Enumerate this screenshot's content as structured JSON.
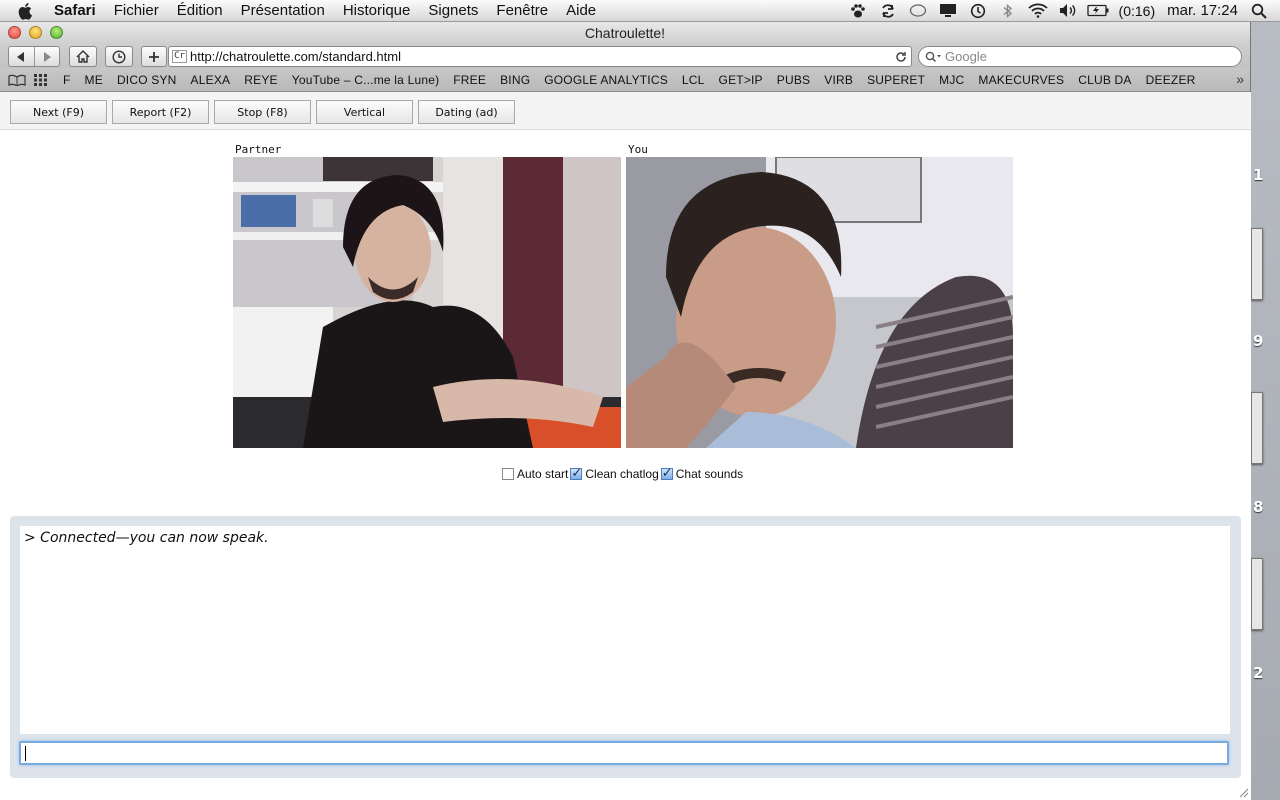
{
  "menubar": {
    "app": "Safari",
    "menus": [
      "Fichier",
      "Édition",
      "Présentation",
      "Historique",
      "Signets",
      "Fenêtre",
      "Aide"
    ],
    "battery": "(0:16)",
    "clock": "mar. 17:24"
  },
  "window": {
    "title": "Chatroulette!"
  },
  "toolbar": {
    "url": "http://chatroulette.com/standard.html",
    "favicon_text": "Cr",
    "search_placeholder": "Google"
  },
  "bookmarks": [
    "F",
    "ME",
    "DICO SYN",
    "ALEXA",
    "REYE",
    "YouTube – C...me la Lune)",
    "FREE",
    "BING",
    "GOOGLE ANALYTICS",
    "LCL",
    "GET>IP",
    "PUBS",
    "VIRB",
    "SUPERET",
    "MJC",
    "MAKECURVES",
    "CLUB DA",
    "DEEZER"
  ],
  "page": {
    "buttons": [
      "Next (F9)",
      "Report (F2)",
      "Stop (F8)",
      "Vertical",
      "Dating (ad)"
    ],
    "partner_label": "Partner",
    "you_label": "You",
    "options": [
      {
        "label": "Auto start",
        "checked": false
      },
      {
        "label": "Clean chatlog",
        "checked": true
      },
      {
        "label": "Chat sounds",
        "checked": true
      }
    ],
    "chatlog": "> Connected—you can now speak."
  },
  "desktop": {
    "numbers": [
      "1",
      "9",
      "8",
      "2"
    ]
  }
}
